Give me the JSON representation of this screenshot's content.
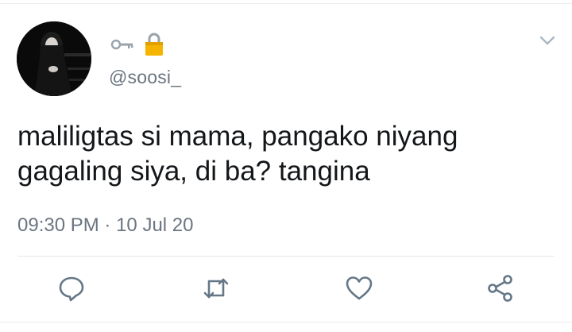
{
  "user": {
    "display_emojis": [
      "🗝",
      "🔒"
    ],
    "handle": "@soosi_",
    "avatar": "profile-photo"
  },
  "tweet": {
    "text": "maliligtas si mama, pangako niyang\ngagaling siya, di ba? tangina",
    "time": "09:30 PM",
    "separator": "·",
    "date": "10 Jul 20"
  },
  "actions": [
    {
      "name": "reply",
      "icon": "speech-bubble-icon"
    },
    {
      "name": "retweet",
      "icon": "retweet-arrows-icon"
    },
    {
      "name": "like",
      "icon": "heart-icon"
    },
    {
      "name": "share",
      "icon": "share-nodes-icon"
    }
  ],
  "colors": {
    "text": "#14171a",
    "muted": "#6b7580",
    "icon": "#657786",
    "divider": "#e1e8ed",
    "lock": "#f4b400"
  }
}
